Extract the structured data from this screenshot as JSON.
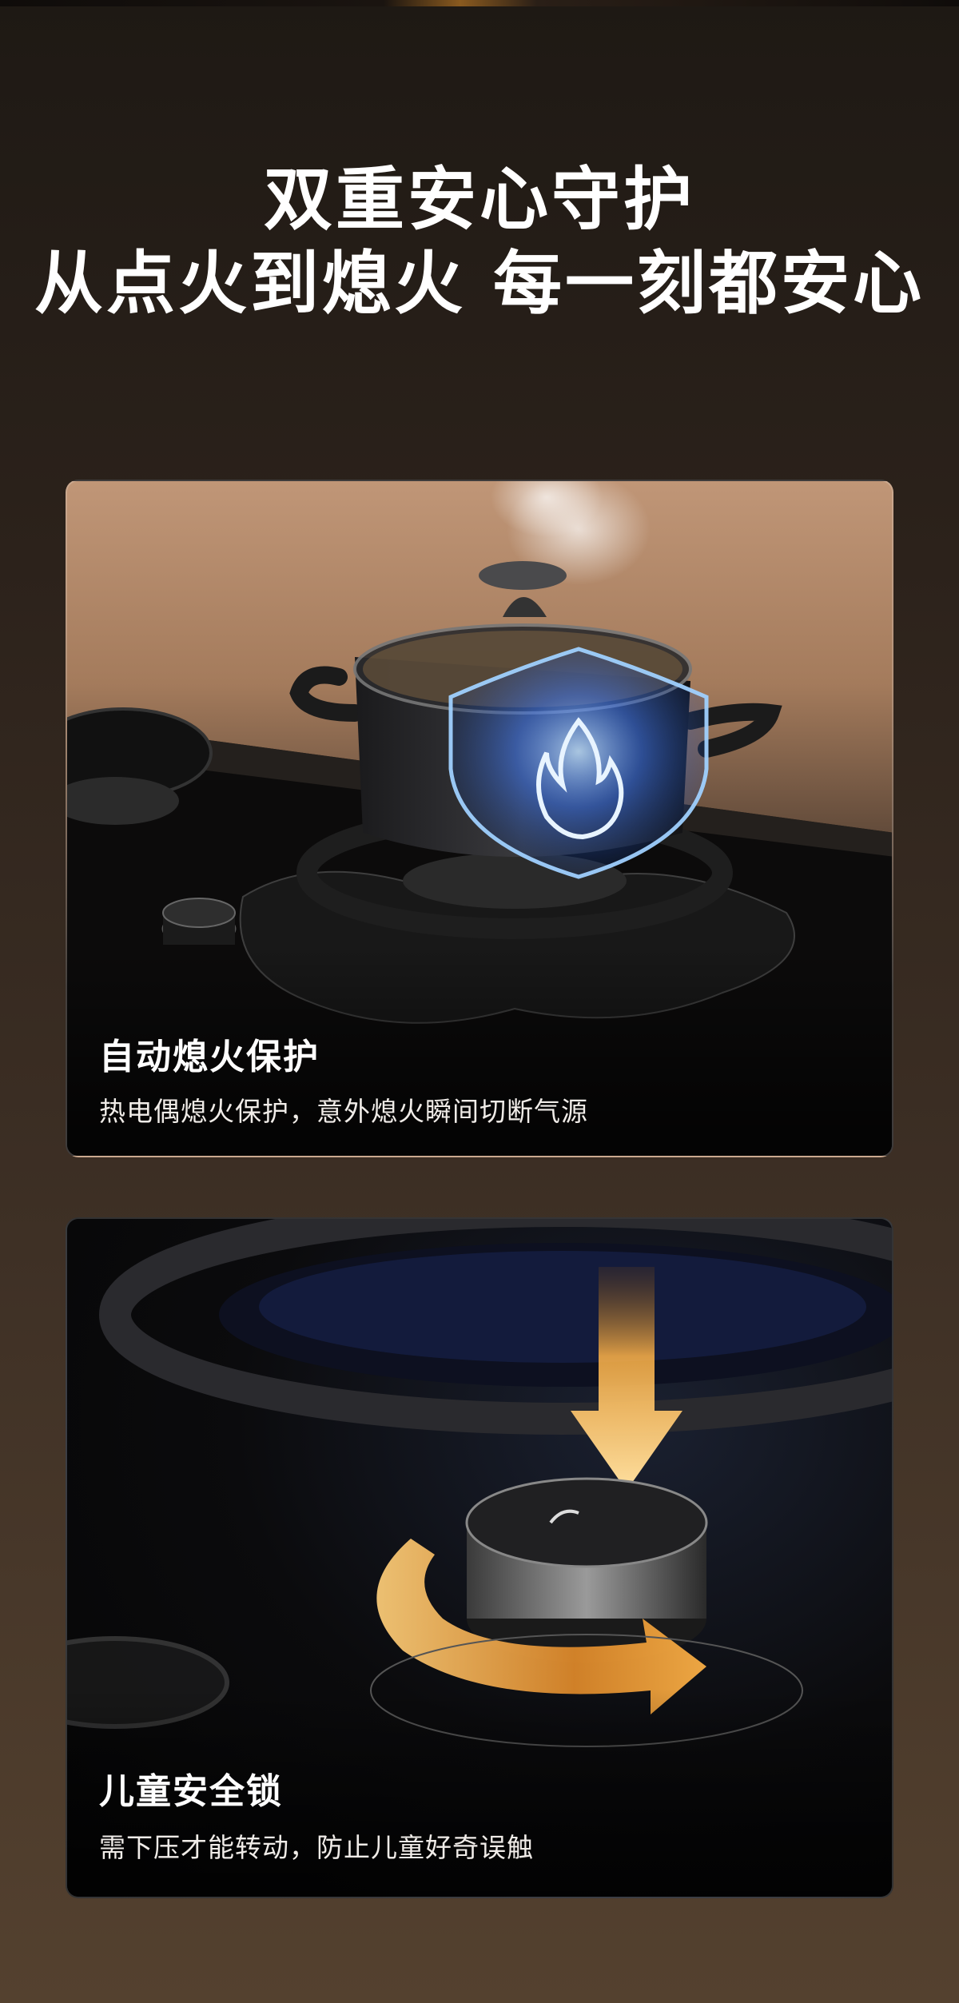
{
  "header": {
    "line1": "双重安心守护",
    "line2": "从点火到熄火 每一刻都安心"
  },
  "features": [
    {
      "title": "自动熄火保护",
      "description": "热电偶熄火保护，意外熄火瞬间切断气源",
      "icon": "flame-shield-icon"
    },
    {
      "title": "儿童安全锁",
      "description": "需下压才能转动，防止儿童好奇误触",
      "icon": "press-rotate-knob-icon"
    }
  ],
  "colors": {
    "shield_glow": "#3d7bff",
    "arrow_glow": "#ffb347"
  }
}
